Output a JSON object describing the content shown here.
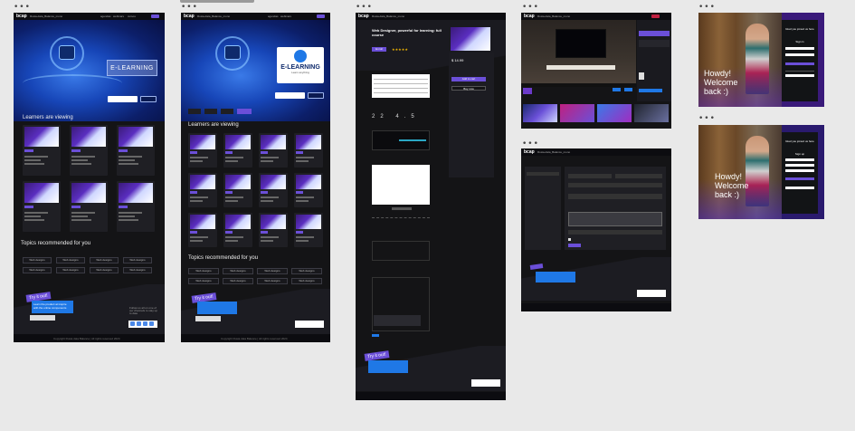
{
  "app": {
    "logo": "bcap",
    "url_text": "Rusia-data_Balance_mono",
    "nav_items": [
      "agendas",
      "webinars",
      "cursos",
      "espacio"
    ]
  },
  "frame1": {
    "hero_title": "E-LEARNING",
    "section_learners": "Learners are viewing",
    "section_topics": "Topics recommended for you",
    "card_badge": "Web design",
    "topics": [
      "Web designs",
      "Web designs",
      "Web designs",
      "Web designs",
      "Web designs",
      "Web designs",
      "Web designs",
      "Web designs"
    ],
    "promo_tag": "Try it out!",
    "promo_text": "Learn the product at inspire with the online components",
    "side_text": "Follow us all on one of our channels to stay up to date",
    "footer": "Copyright Rusia data Balance | All rights reserved 2024"
  },
  "frame2": {
    "hero_title": "E-LEARNING",
    "hero_subtitle": "Learn anything",
    "section_learners": "Learners are viewing",
    "section_topics": "Topics recommended for you",
    "topics": [
      "Web designs",
      "Web designs",
      "Web designs",
      "Web designs",
      "Web designs",
      "Web designs",
      "Web designs",
      "Web designs"
    ],
    "promo_tag": "Try it out!",
    "footer": "Copyright Rusia data Balance | All rights reserved 2024"
  },
  "frame3": {
    "course_title": "Web Designer, powerful for learning: full course",
    "enroll": "Enroll",
    "price": "$ 14.99",
    "add_cart": "Add to cart",
    "buy_now": "Buy now",
    "promo_tag": "Try it out!"
  },
  "frame5": {
    "welcome_line1": "Howdy!",
    "welcome_line2": "Welcome",
    "welcome_line3": "back :)",
    "panel_title": "Glad you joined us here",
    "sign_in": "Sign in"
  },
  "frame6": {
    "welcome_line1": "Howdy!",
    "welcome_line2": "Welcome",
    "welcome_line3": "back :)",
    "panel_title": "Glad you joined us here",
    "sign_up": "Sign up"
  },
  "colors": {
    "accent": "#6b4fd8",
    "frame_bg": "#141416",
    "hero_blue": "#1746b8",
    "canvas": "#e9e9e9"
  }
}
